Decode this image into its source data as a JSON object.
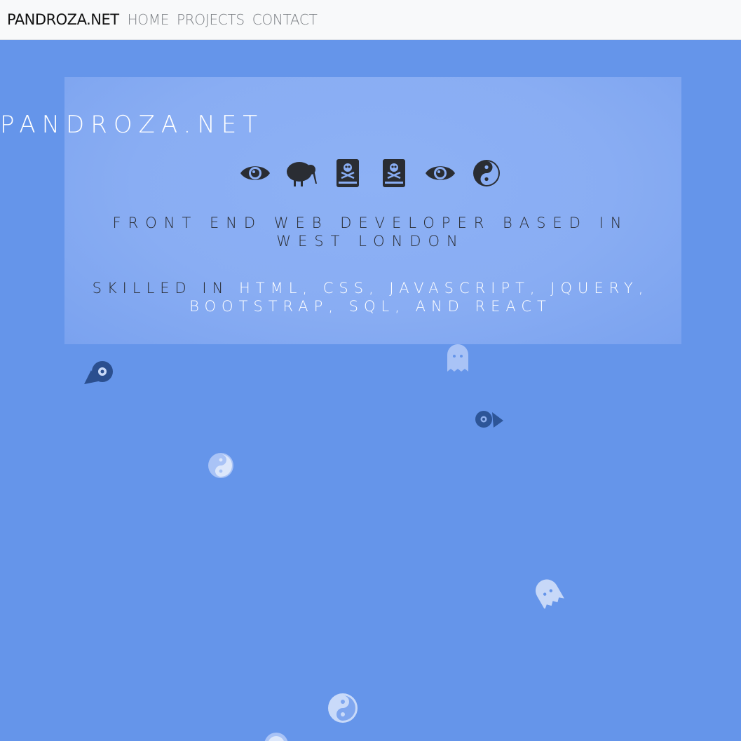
{
  "nav": {
    "brand": "Pandroza.net",
    "links": [
      "Home",
      "Projects",
      "Contact"
    ]
  },
  "hero": {
    "title": "PANDROZA.NET",
    "icons": [
      "eye-icon",
      "kiwi-bird-icon",
      "book-dead-icon",
      "book-dead-icon",
      "eye-icon",
      "yin-yang-icon"
    ],
    "tagline": "FRONT END WEB DEVELOPER BASED IN WEST LONDON",
    "skills_prefix": "SKILLED IN ",
    "skills_list": "HTML, CSS, JAVASCRIPT, JQUERY, BOOTSTRAP, SQL, AND REACT"
  },
  "colors": {
    "background": "#6595ea",
    "panel": "#89adf3",
    "navbar": "#f8f9fa",
    "dark": "#2a2d33",
    "highlight": "#ffffff"
  },
  "sprites": [
    "comet-icon",
    "ghost-icon",
    "comet-icon",
    "yin-yang-icon",
    "ghost-icon",
    "yin-yang-icon",
    "yin-yang-icon"
  ]
}
